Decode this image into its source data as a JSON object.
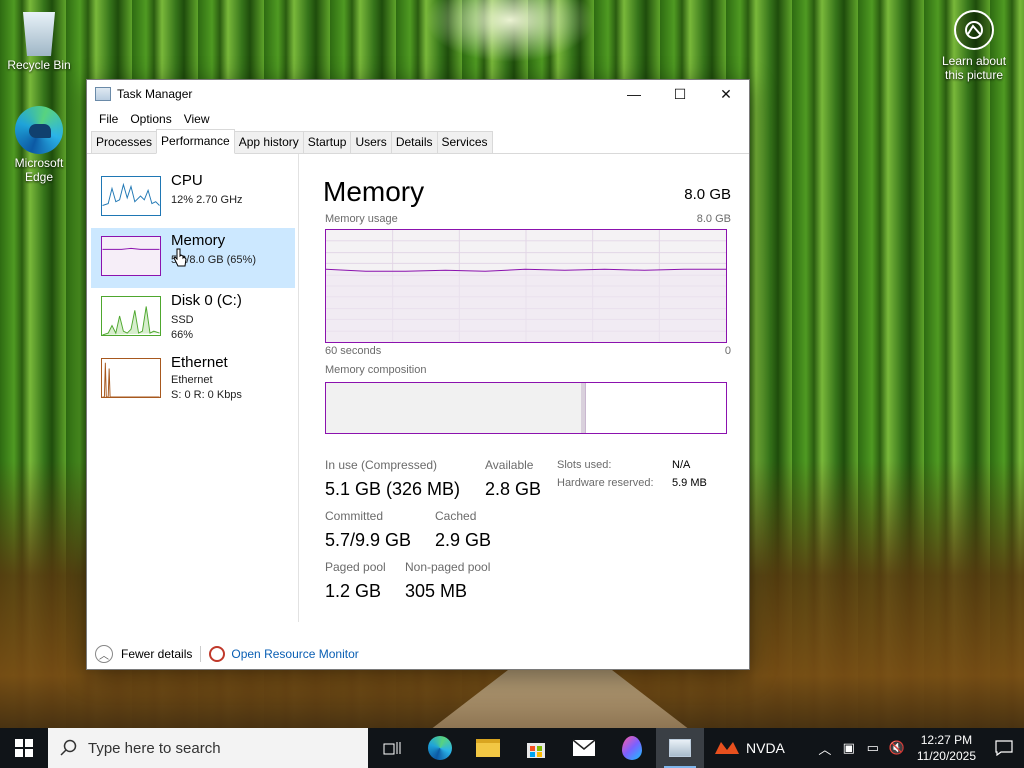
{
  "desktop": {
    "icons": [
      {
        "label": "Recycle Bin"
      },
      {
        "label": "Microsoft Edge"
      }
    ],
    "learn": {
      "label": "Learn about this picture"
    }
  },
  "window": {
    "title": "Task Manager",
    "controls": {
      "minimize": "—",
      "maximize": "☐",
      "close": "✕"
    },
    "menu": [
      "File",
      "Options",
      "View"
    ],
    "tabs": [
      "Processes",
      "Performance",
      "App history",
      "Startup",
      "Users",
      "Details",
      "Services"
    ],
    "active_tab": "Performance",
    "sidebar": [
      {
        "title": "CPU",
        "sub1": "12%  2.70 GHz",
        "sub2": "",
        "color": "#1f77b4"
      },
      {
        "title": "Memory",
        "sub1": "5.2/8.0 GB (65%)",
        "sub2": "",
        "color": "#8b12ae"
      },
      {
        "title": "Disk 0 (C:)",
        "sub1": "SSD",
        "sub2": "66%",
        "color": "#4ea72e"
      },
      {
        "title": "Ethernet",
        "sub1": "Ethernet",
        "sub2": "S: 0  R: 0 Kbps",
        "color": "#a7581e"
      }
    ],
    "memory": {
      "title": "Memory",
      "total": "8.0 GB",
      "usage_label": "Memory usage",
      "usage_max": "8.0 GB",
      "time_left": "60 seconds",
      "time_right": "0",
      "composition_label": "Memory composition",
      "in_use_fraction": 0.65,
      "stats": {
        "in_use_label": "In use (Compressed)",
        "in_use_value": "5.1 GB (326 MB)",
        "available_label": "Available",
        "available_value": "2.8 GB",
        "committed_label": "Committed",
        "committed_value": "5.7/9.9 GB",
        "cached_label": "Cached",
        "cached_value": "2.9 GB",
        "paged_label": "Paged pool",
        "paged_value": "1.2 GB",
        "nonpaged_label": "Non-paged pool",
        "nonpaged_value": "305 MB",
        "slots_label": "Slots used:",
        "slots_value": "N/A",
        "hw_label": "Hardware reserved:",
        "hw_value": "5.9 MB"
      }
    },
    "footer": {
      "fewer_details": "Fewer details",
      "open_monitor": "Open Resource Monitor"
    }
  },
  "taskbar": {
    "search_placeholder": "Type here to search",
    "nvda_label": "NVDA",
    "time": "12:27 PM",
    "date": "11/20/2025"
  }
}
